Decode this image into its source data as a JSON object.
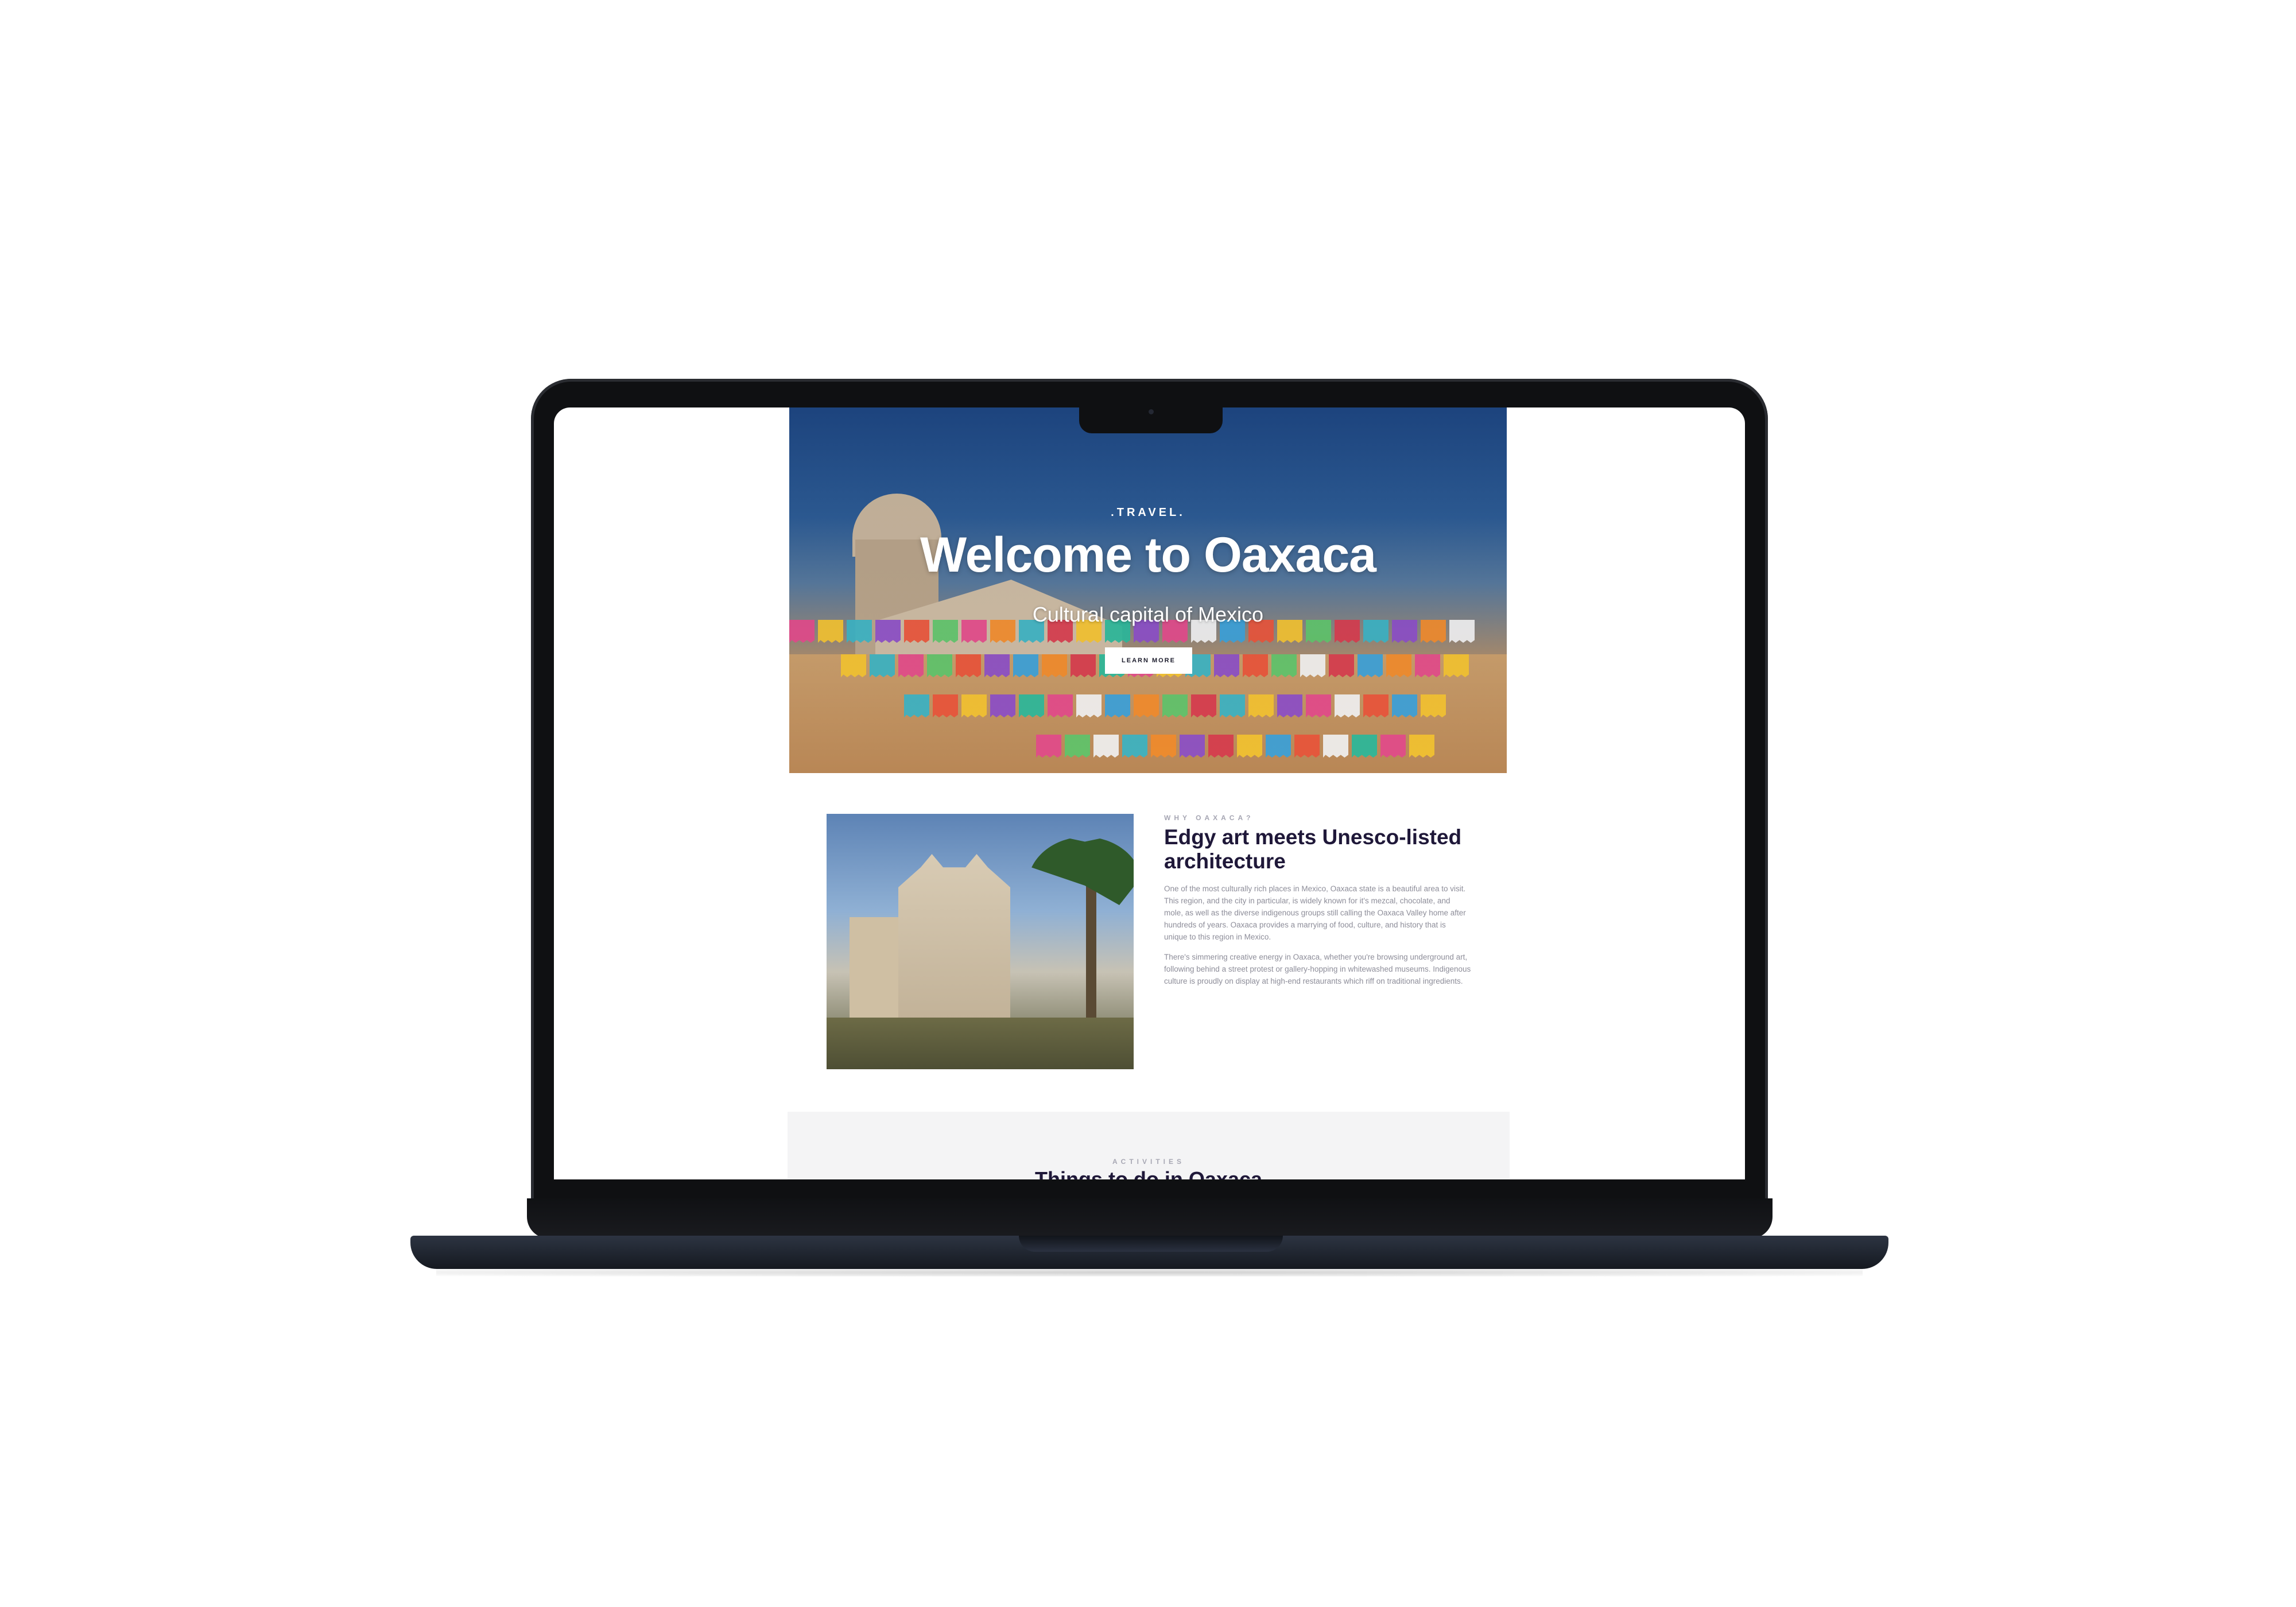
{
  "hero": {
    "overline": ".TRAVEL.",
    "title": "Welcome to Oaxaca",
    "subtitle": "Cultural capital of Mexico",
    "button_label": "LEARN MORE"
  },
  "about": {
    "kicker": "WHY OAXACA?",
    "heading": "Edgy art meets Unesco-listed architecture",
    "paragraphs": [
      "One of the most culturally rich places in Mexico, Oaxaca state is a beautiful area to visit. This region, and the city in particular, is widely known for it's mezcal, chocolate, and mole, as well as the diverse indigenous groups still calling the Oaxaca Valley home after hundreds of years. Oaxaca provides a marrying of food, culture, and history that is unique to this region in Mexico.",
      "There's simmering creative energy in Oaxaca, whether you're browsing underground art, following behind a street protest or gallery-hopping in whitewashed museums. Indigenous culture is proudly on display at high-end restaurants which riff on traditional ingredients."
    ]
  },
  "activities": {
    "kicker": "ACTIVITIES",
    "title": "Things to do in Oaxaca"
  },
  "colors": {
    "heading_navy": "#1f1839",
    "laptop_body": "#0f1012",
    "laptop_base": "#2d3442",
    "hero_sky": "#1d4580"
  },
  "icons": {
    "camera": "webcam-icon"
  }
}
